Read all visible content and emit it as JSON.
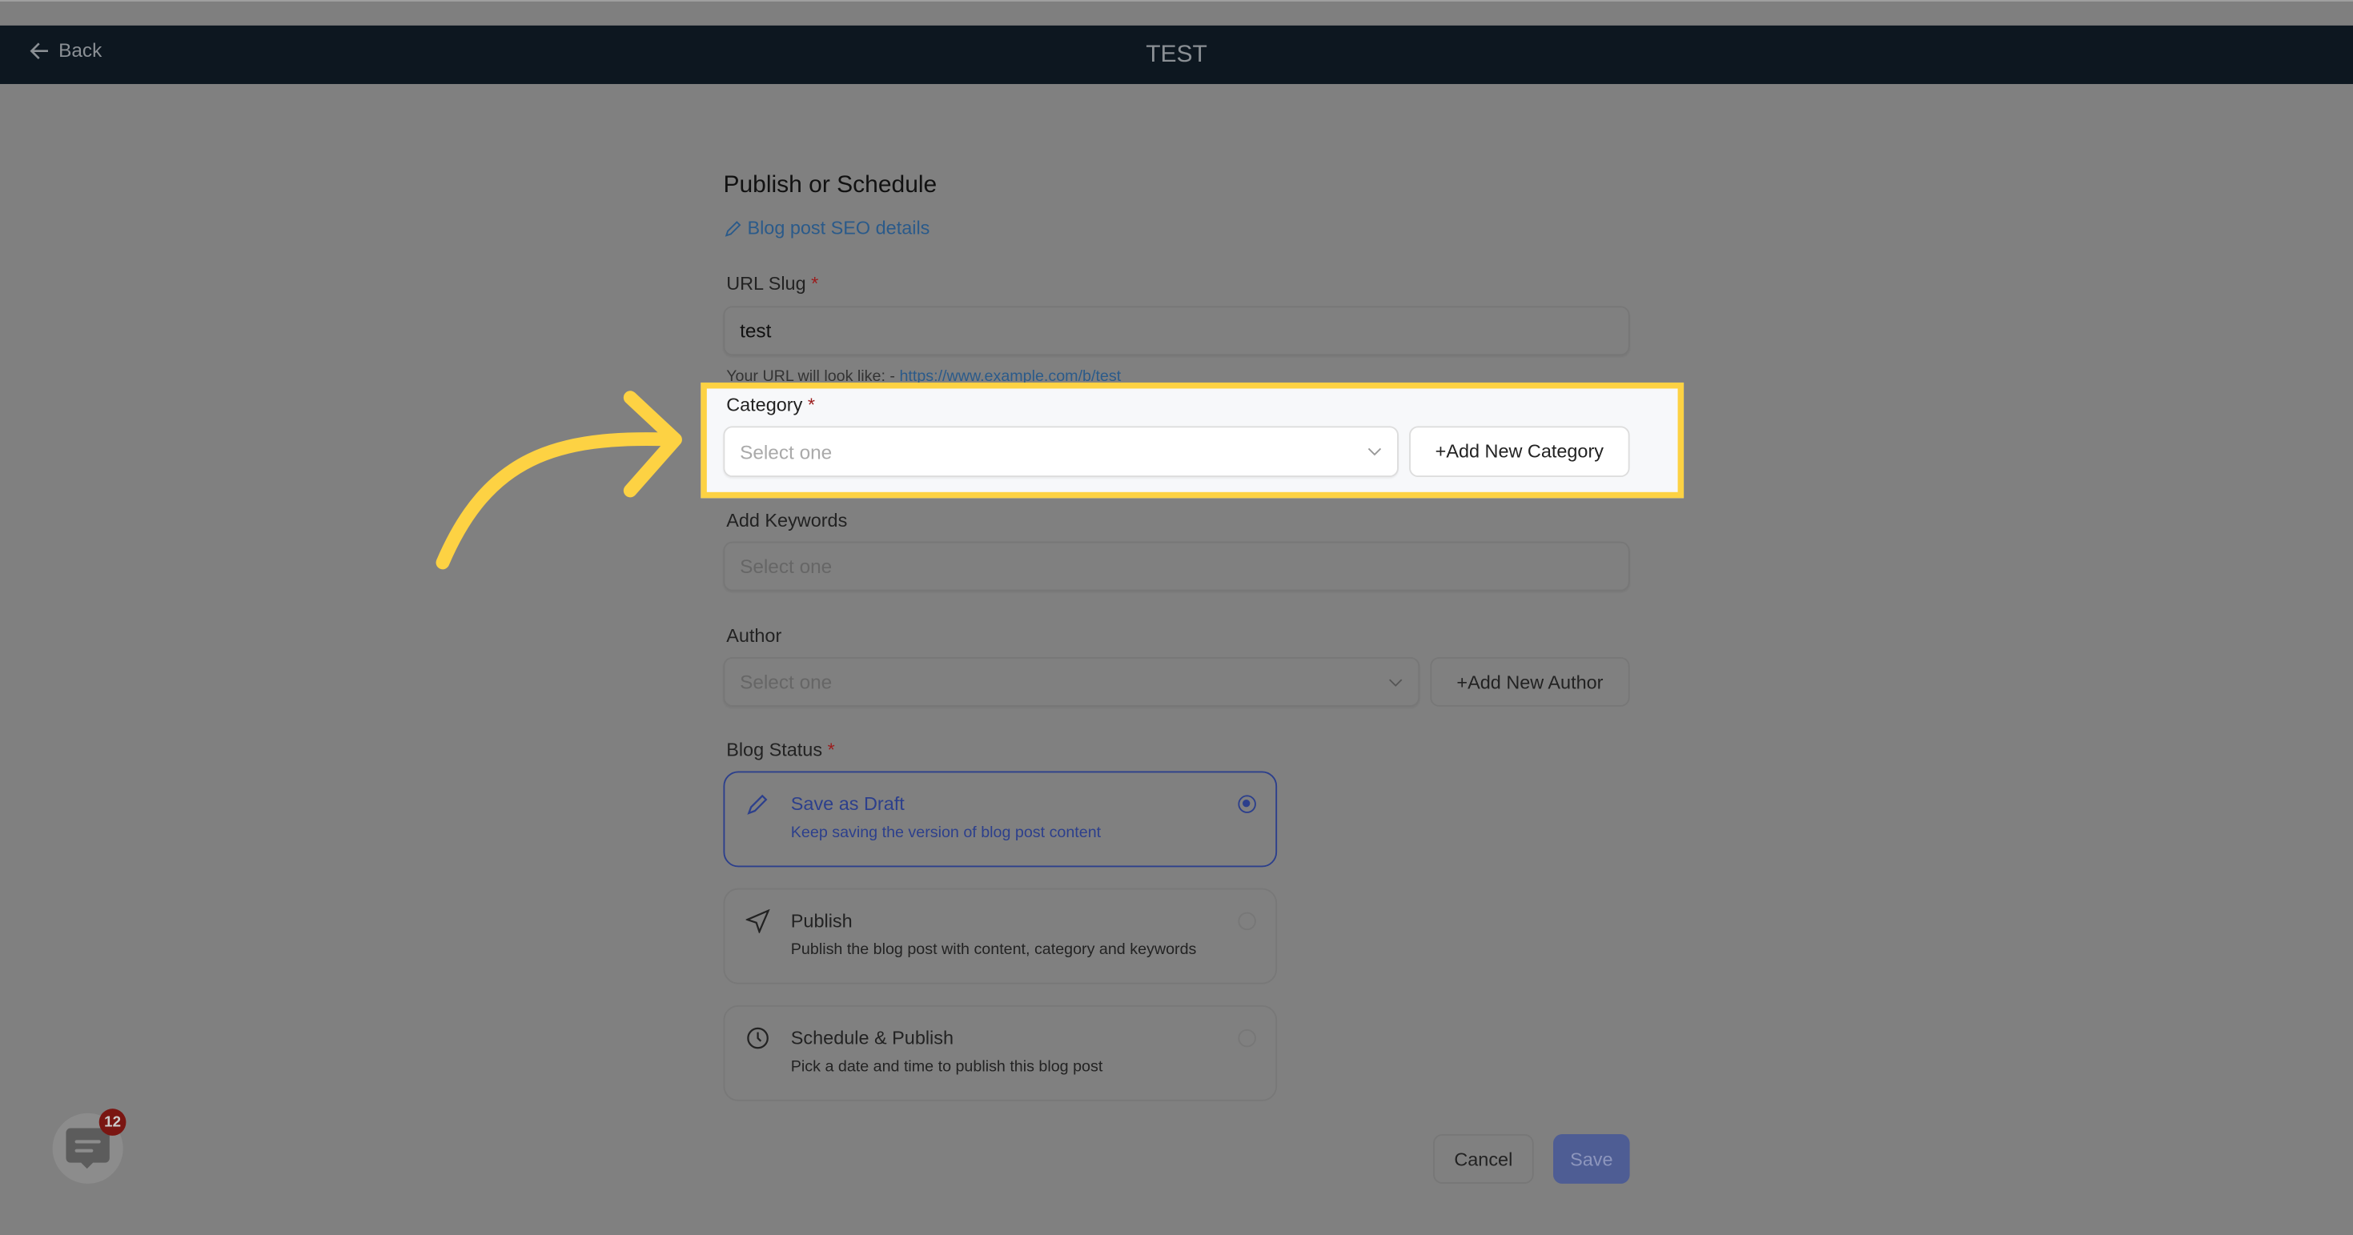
{
  "header": {
    "back_label": "Back",
    "title": "TEST"
  },
  "form": {
    "heading": "Publish or Schedule",
    "seo_link": "Blog post SEO details",
    "url_slug": {
      "label": "URL Slug",
      "required": "*",
      "value": "test",
      "hint_prefix": "Your URL will look like: - ",
      "hint_url": "https://www.example.com/b/test"
    },
    "category": {
      "label": "Category",
      "required": "*",
      "placeholder": "Select one",
      "add_button": "Add New Category"
    },
    "keywords": {
      "label": "Add Keywords",
      "placeholder": "Select one"
    },
    "author": {
      "label": "Author",
      "placeholder": "Select one",
      "add_button": "Add New Author"
    },
    "blog_status": {
      "label": "Blog Status",
      "required": "*",
      "options": [
        {
          "title": "Save as Draft",
          "desc": "Keep saving the version of blog post content",
          "icon": "pencil-icon",
          "selected": true
        },
        {
          "title": "Publish",
          "desc": "Publish the blog post with content, category and keywords",
          "icon": "send-icon",
          "selected": false
        },
        {
          "title": "Schedule & Publish",
          "desc": "Pick a date and time to publish this blog post",
          "icon": "clock-icon",
          "selected": false
        }
      ]
    },
    "cancel_label": "Cancel",
    "save_label": "Save"
  },
  "chat_widget": {
    "badge_count": "12"
  },
  "colors": {
    "highlight": "#fdd243",
    "accent": "#2c3f8c",
    "header_bg": "#0d1720"
  }
}
